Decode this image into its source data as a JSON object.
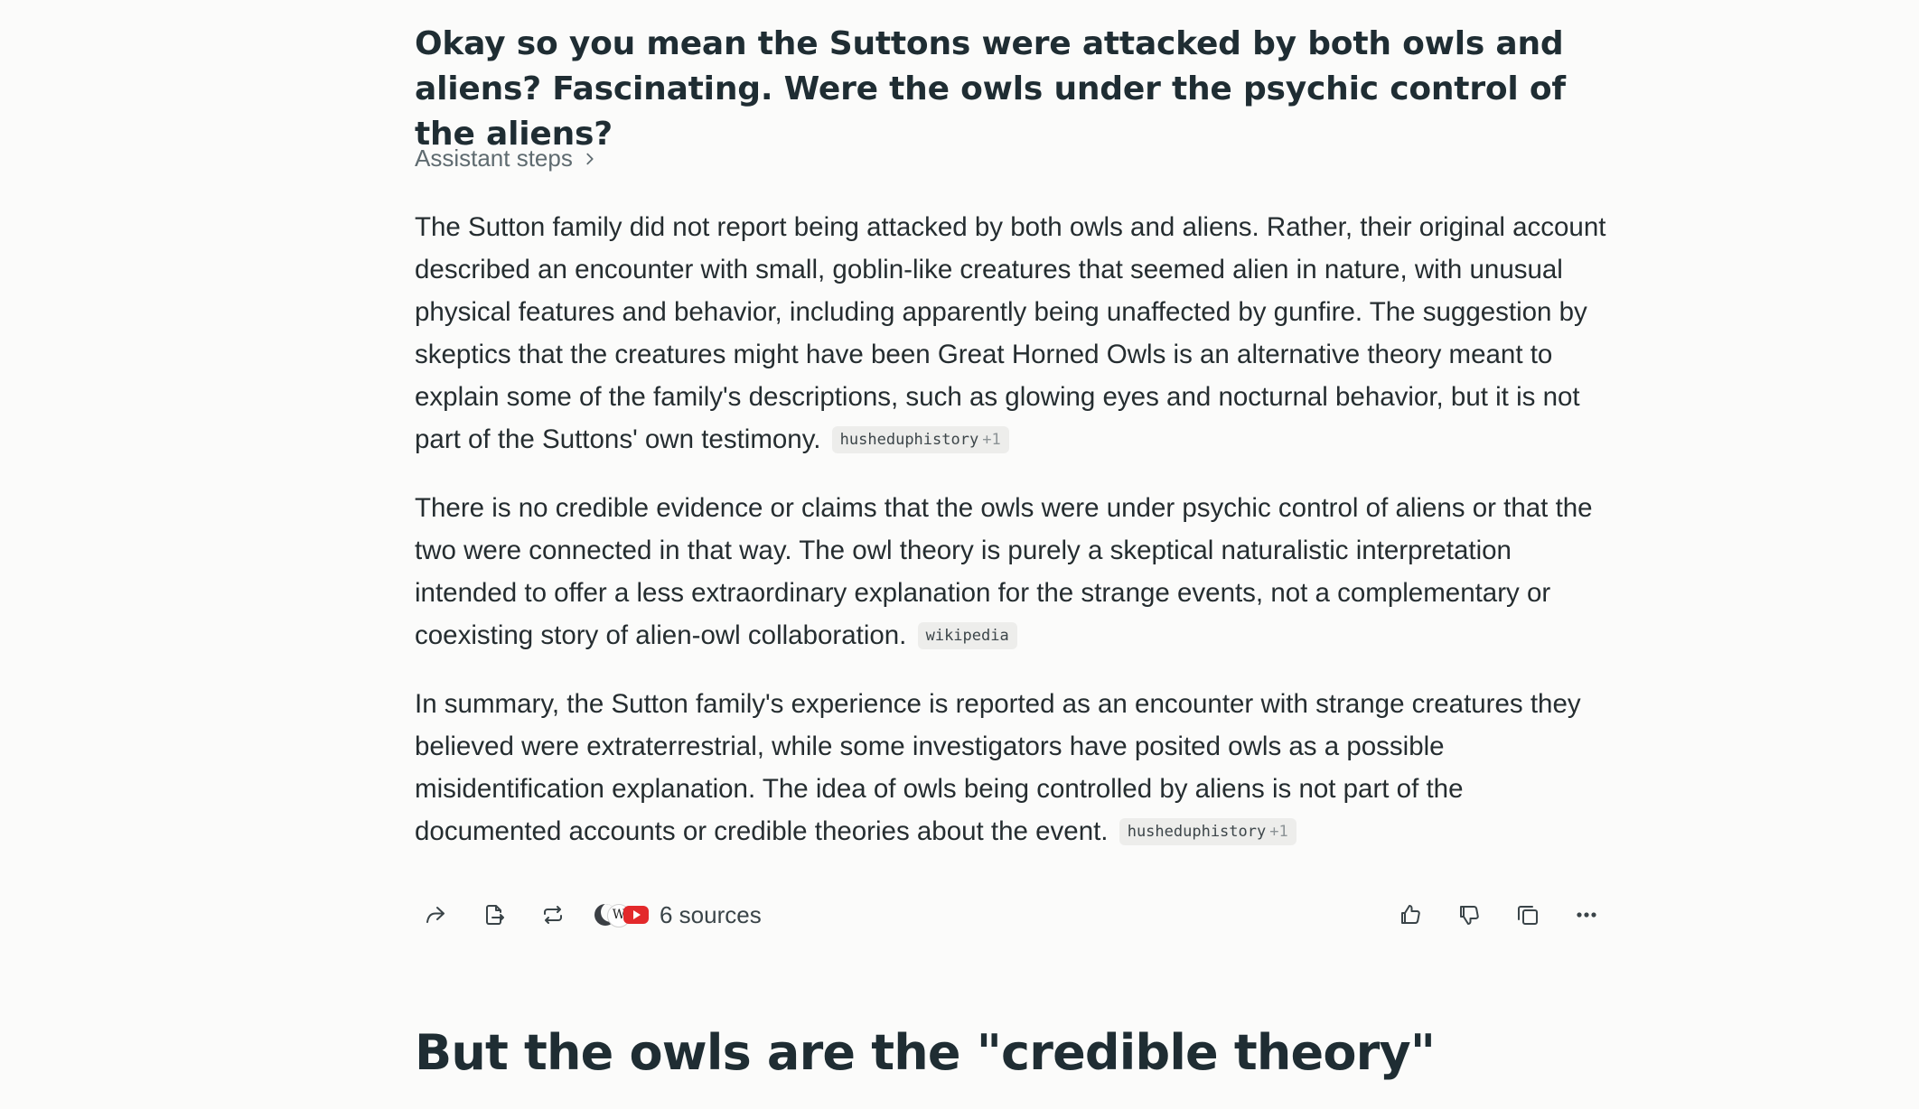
{
  "query": {
    "text": "Okay so you mean the Suttons were attacked by both owls and aliens? Fascinating. Were the owls under the psychic control of the aliens?"
  },
  "assistant_steps": {
    "label": "Assistant steps"
  },
  "answer": {
    "paragraphs": [
      {
        "text": "The Sutton family did not report being attacked by both owls and aliens. Rather, their original account described an encounter with small, goblin-like creatures that seemed alien in nature, with unusual physical features and behavior, including apparently being unaffected by gunfire. The suggestion by skeptics that the creatures might have been Great Horned Owls is an alternative theory meant to explain some of the family's descriptions, such as glowing eyes and nocturnal behavior, but it is not part of the Suttons' own testimony.",
        "citation": {
          "source": "husheduphistory",
          "extra": "+1"
        }
      },
      {
        "text": "There is no credible evidence or claims that the owls were under psychic control of aliens or that the two were connected in that way. The owl theory is purely a skeptical naturalistic interpretation intended to offer a less extraordinary explanation for the strange events, not a complementary or coexisting story of alien-owl collaboration.",
        "citation": {
          "source": "wikipedia",
          "extra": ""
        }
      },
      {
        "text": "In summary, the Sutton family's experience is reported as an encounter with strange creatures they believed were extraterrestrial, while some investigators have posited owls as a possible misidentification explanation. The idea of owls being controlled by aliens is not part of the documented accounts or credible theories about the event.",
        "citation": {
          "source": "husheduphistory",
          "extra": "+1"
        }
      }
    ]
  },
  "actions": {
    "left_icons": [
      "share-icon",
      "export-icon",
      "rewrite-icon"
    ],
    "sources_label": "6 sources",
    "source_favicons": [
      "moon-favicon",
      "wikipedia-favicon",
      "youtube-favicon"
    ],
    "wiki_letter": "W",
    "right_icons": [
      "thumbs-up-icon",
      "thumbs-down-icon",
      "copy-icon",
      "more-icon"
    ]
  },
  "followup_query": {
    "text": "But the owls are the \"credible theory\""
  }
}
